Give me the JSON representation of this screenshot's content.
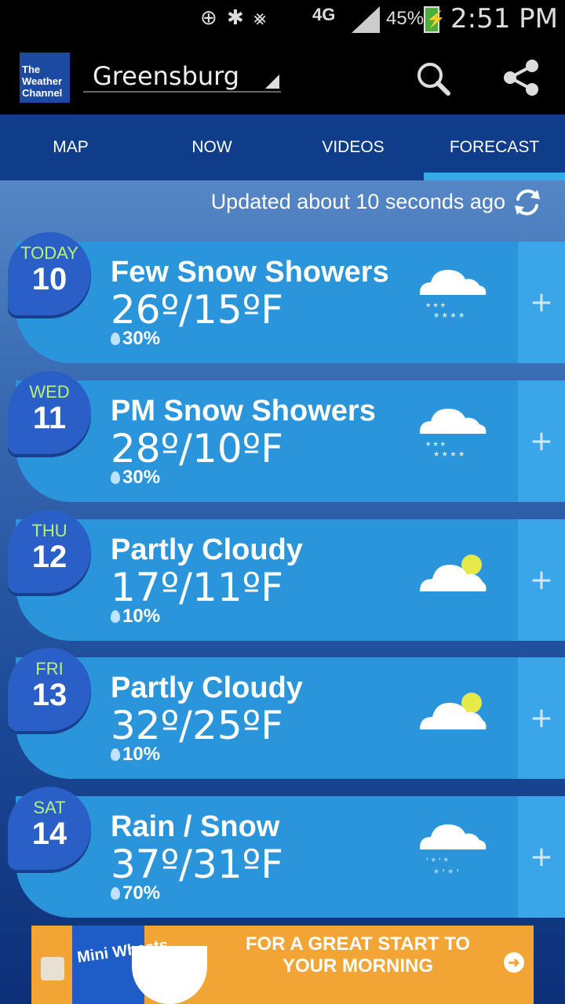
{
  "status_bar": {
    "network": "4G",
    "battery": "45%",
    "time": "2:51 PM"
  },
  "app": {
    "logo_line1": "The",
    "logo_line2": "Weather",
    "logo_line3": "Channel",
    "location": "Greensburg"
  },
  "tabs": [
    {
      "label": "MAP",
      "active": false
    },
    {
      "label": "NOW",
      "active": false
    },
    {
      "label": "VIDEOS",
      "active": false
    },
    {
      "label": "FORECAST",
      "active": true
    }
  ],
  "updated_text": "Updated about 10 seconds ago",
  "forecast": [
    {
      "day": "TODAY",
      "date": "10",
      "condition": "Few Snow Showers",
      "temps": "26º/15ºF",
      "precip": "30%",
      "icon": "snow-cloud-icon"
    },
    {
      "day": "WED",
      "date": "11",
      "condition": "PM Snow Showers",
      "temps": "28º/10ºF",
      "precip": "30%",
      "icon": "snow-cloud-icon"
    },
    {
      "day": "THU",
      "date": "12",
      "condition": "Partly Cloudy",
      "temps": "17º/11ºF",
      "precip": "10%",
      "icon": "partly-cloudy-icon"
    },
    {
      "day": "FRI",
      "date": "13",
      "condition": "Partly Cloudy",
      "temps": "32º/25ºF",
      "precip": "10%",
      "icon": "partly-cloudy-icon"
    },
    {
      "day": "SAT",
      "date": "14",
      "condition": "Rain / Snow",
      "temps": "37º/31ºF",
      "precip": "70%",
      "icon": "rain-snow-icon"
    }
  ],
  "expand_label": "+",
  "ad": {
    "line1": "FOR A GREAT START TO",
    "line2": "YOUR MORNING",
    "product": "Mini Wheats"
  },
  "colors": {
    "tab_bar": "#0f3d8a",
    "active_tab_indicator": "#3aa9e8",
    "row_bg": "#2b95dc",
    "day_badge": "#2a5fc8",
    "day_label": "#b8f07a",
    "ad_bg": "#f2a535"
  }
}
